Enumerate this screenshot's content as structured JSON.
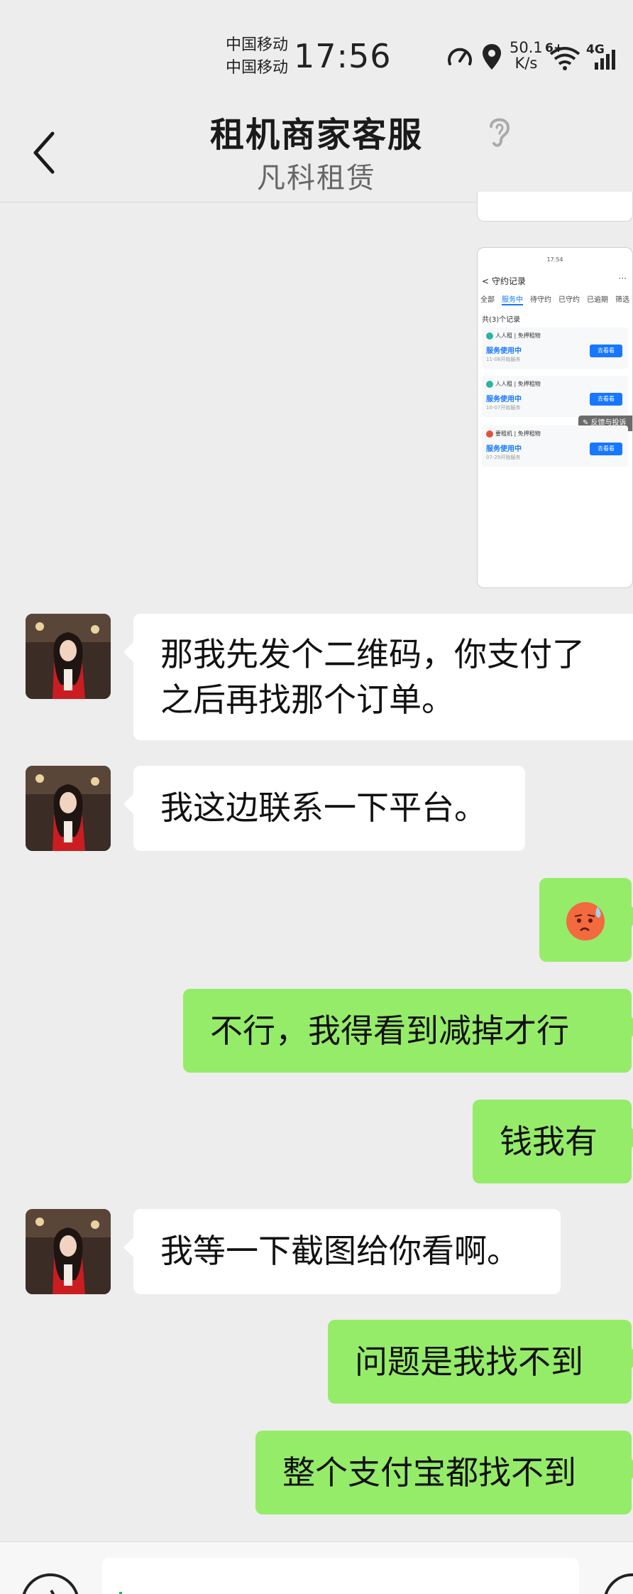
{
  "status_bar": {
    "carrier1": "中国移动",
    "carrier2": "中国移动",
    "time": "17:56",
    "speed_value": "50.1",
    "speed_unit": "K/s",
    "net1": "6+",
    "net2": "4G"
  },
  "header": {
    "title": "租机商家客服",
    "subtitle": "凡科租赁"
  },
  "shared_screenshot": {
    "status_time": "17:54",
    "page_title": "守约记录",
    "more": "···",
    "tabs": [
      "全部",
      "服务中",
      "待守约",
      "已守约",
      "已逾期",
      "筛选"
    ],
    "active_tab": 1,
    "count_text": "共(3)个记录",
    "cards": [
      {
        "brand": "人人租 | 免押租物",
        "status": "服务使用中",
        "date": "11-08开始服务",
        "button": "去看看",
        "color": "#2bb5a0"
      },
      {
        "brand": "人人租 | 免押租物",
        "status": "服务使用中",
        "date": "10-07开始服务",
        "button": "去看看",
        "color": "#2bb5a0"
      },
      {
        "brand": "要租机 | 免押租物",
        "status": "服务使用中",
        "date": "07-29开始服务",
        "button": "去看看",
        "color": "#e0533b"
      }
    ],
    "feedback": "反馈与投诉"
  },
  "messages": [
    {
      "side": "in",
      "lines": [
        "那我先发个二维码，你支付了",
        "之后再找那个订单。"
      ]
    },
    {
      "side": "in",
      "lines": [
        "我这边联系一下平台。"
      ]
    },
    {
      "side": "out",
      "emoji": "sweat-face"
    },
    {
      "side": "out",
      "lines": [
        "不行，我得看到减掉才行"
      ]
    },
    {
      "side": "out",
      "lines": [
        "钱我有"
      ]
    },
    {
      "side": "in",
      "lines": [
        "我等一下截图给你看啊。"
      ]
    },
    {
      "side": "out",
      "lines": [
        "问题是我找不到"
      ]
    },
    {
      "side": "out",
      "lines": [
        "整个支付宝都找不到"
      ]
    }
  ],
  "colors": {
    "background": "#ededed",
    "bubble_in": "#ffffff",
    "bubble_out": "#95ec69",
    "link_blue": "#1677ff",
    "caret": "#07c160"
  }
}
